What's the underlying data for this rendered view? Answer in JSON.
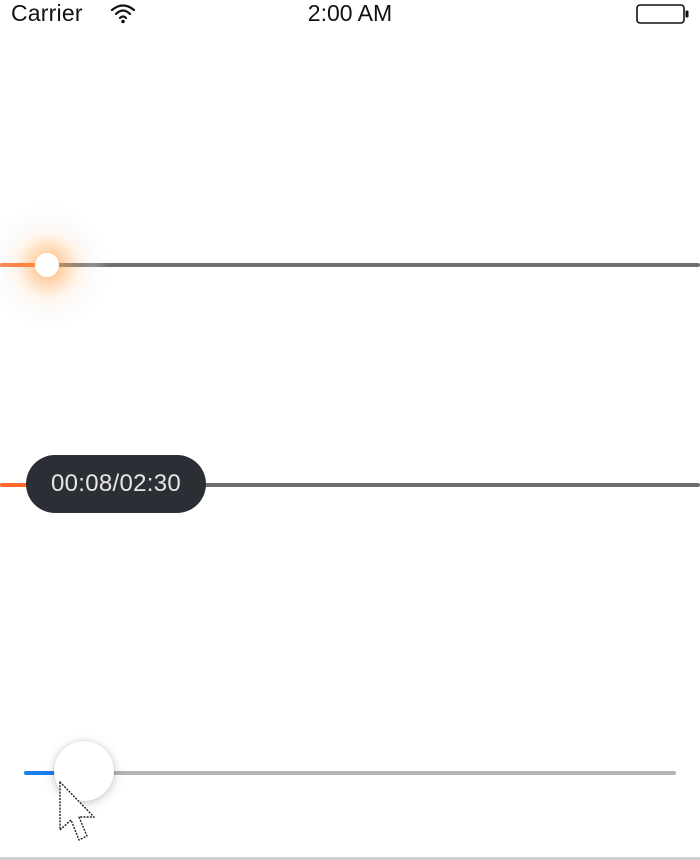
{
  "status_bar": {
    "carrier": "Carrier",
    "time": "2:00 AM"
  },
  "sliders": [
    {
      "value_fraction": 0.06,
      "accent": "#ff6a2a",
      "state": "focused"
    },
    {
      "value_fraction": 0.04,
      "accent": "#ff6a2a",
      "tooltip": "00:08/02:30"
    },
    {
      "value_fraction": 0.06,
      "accent": "#1e7ef0",
      "state": "dragging"
    }
  ],
  "colors": {
    "track": "#6f6f6f",
    "track_light": "#b4b4b4",
    "tooltip_bg": "#2c2e36"
  },
  "icons": [
    "wifi-icon",
    "battery-icon",
    "cursor-icon"
  ]
}
